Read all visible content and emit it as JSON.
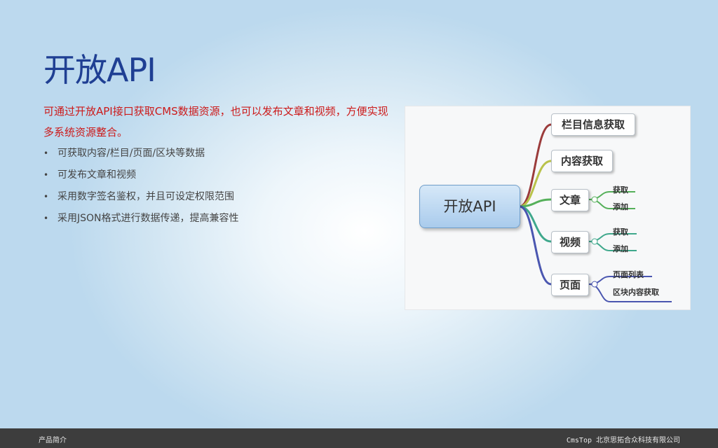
{
  "slide": {
    "title": "开放API",
    "lead": "可通过开放API接口获取CMS数据资源，也可以发布文章和视频，方便实现多系统资源整合。",
    "bullets": [
      "可获取内容/栏目/页面/区块等数据",
      "可发布文章和视频",
      "采用数字签名鉴权，并且可设定权限范围",
      "采用JSON格式进行数据传递，提高兼容性"
    ]
  },
  "mindmap": {
    "root": "开放API",
    "branches": [
      {
        "label": "栏目信息获取",
        "color": "#9b3b3b",
        "children": []
      },
      {
        "label": "内容获取",
        "color": "#b9c24a",
        "children": []
      },
      {
        "label": "文章",
        "color": "#55b05a",
        "children": [
          "获取",
          "添加"
        ]
      },
      {
        "label": "视频",
        "color": "#3fa88c",
        "children": [
          "获取",
          "添加"
        ]
      },
      {
        "label": "页面",
        "color": "#4a56b0",
        "children": [
          "页面列表",
          "区块内容获取"
        ]
      }
    ]
  },
  "footer": {
    "section": "产品简介",
    "brand": "CmsTop",
    "company": "北京思拓合众科技有限公司"
  }
}
